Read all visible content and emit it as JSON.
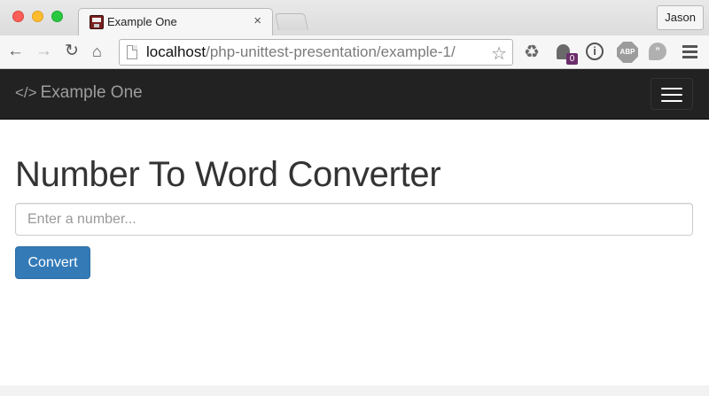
{
  "browser": {
    "tab": {
      "title": "Example One",
      "favicon": "floppy-disk-icon",
      "close_glyph": "×"
    },
    "profile_name": "Jason",
    "url": {
      "host": "localhost",
      "path": "/php-unittest-presentation/example-1/"
    },
    "extensions": {
      "ghostery_badge": "0",
      "adblock_label": "ABP",
      "info_glyph": "i",
      "hangouts_glyph": "”"
    },
    "icons": {
      "back": "←",
      "forward": "→",
      "reload": "↻",
      "home": "⌂",
      "star": "☆",
      "recycle": "♻"
    }
  },
  "navbar": {
    "brand_icon": "</>",
    "brand_text": "Example One"
  },
  "main": {
    "title": "Number To Word Converter",
    "input": {
      "placeholder": "Enter a number...",
      "value": ""
    },
    "convert_label": "Convert"
  },
  "colors": {
    "navbar_bg": "#222222",
    "brand_text": "#9d9d9d",
    "primary_button": "#337ab7"
  }
}
